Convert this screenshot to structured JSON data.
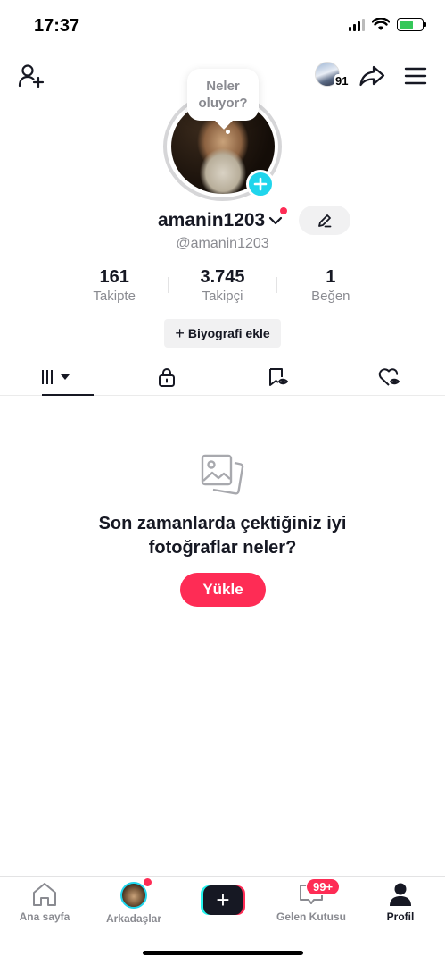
{
  "status_bar": {
    "time": "17:37",
    "battery_level": 0.6
  },
  "header": {
    "viewer_count": "91"
  },
  "profile": {
    "story_prompt": "Neler\noluyor?",
    "username": "amanin1203",
    "handle": "@amanin1203",
    "stats": [
      {
        "value": "161",
        "label": "Takipte"
      },
      {
        "value": "3.745",
        "label": "Takipçi"
      },
      {
        "value": "1",
        "label": "Beğen"
      }
    ],
    "bio_button_label": "Biyografi ekle",
    "bio_button_prefix": "+"
  },
  "tabs": [
    {
      "icon": "grid-icon",
      "active": true
    },
    {
      "icon": "lock-icon",
      "active": false
    },
    {
      "icon": "bookmark-icon",
      "active": false
    },
    {
      "icon": "liked-heart-icon",
      "active": false
    }
  ],
  "empty_state": {
    "title": "Son zamanlarda çektiğiniz iyi\nfotoğraflar neler?",
    "button_label": "Yükle"
  },
  "bottom_nav": {
    "home_label": "Ana sayfa",
    "friends_label": "Arkadaşlar",
    "create_label": "+",
    "inbox_label": "Gelen Kutusu",
    "inbox_badge": "99+",
    "profile_label": "Profil"
  },
  "colors": {
    "accent": "#fe2c55",
    "cyan": "#20d5ec",
    "text": "#161823",
    "muted": "#8a8b91"
  }
}
